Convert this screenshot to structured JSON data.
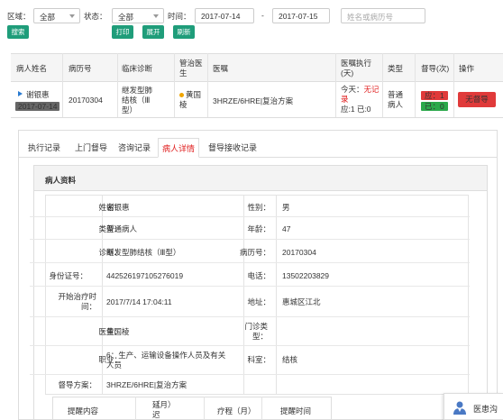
{
  "filters": {
    "region_label": "区域：",
    "region_value": "全部",
    "status_label": "状态：",
    "status_value": "全部",
    "time_label": "时间：",
    "date_from": "2017-07-14",
    "date_sep": "-",
    "date_to": "2017-07-15",
    "search_placeholder": "姓名或病历号",
    "search_btn": "搜索",
    "print_btn": "打印",
    "expand_btn": "展开",
    "refresh_btn": "刷新"
  },
  "table": {
    "headers": [
      "病人姓名",
      "病历号",
      "临床诊断",
      "管治医生",
      "医嘱",
      "医嘱执行(天)",
      "类型",
      "督导(次)",
      "操作"
    ],
    "row": {
      "name": "谢银惠",
      "date": "2017-07-14",
      "record_no": "20170304",
      "diagnosis_l1": "继发型肺",
      "diagnosis_l2": "结核（Ⅲ",
      "diagnosis_l3": "型）",
      "doctor_l1": "黄国",
      "doctor_l2": "棱",
      "order": "3HRZE/6HRE|复治方案",
      "exec_today": "今天：",
      "exec_status_l1": "无记",
      "exec_status_l2": "录",
      "exec_counts": "应:1 已:0",
      "type_l1": "普通",
      "type_l2": "病人",
      "due_badge": "应：1",
      "done_badge": "已：0",
      "action_btn": "无督导"
    }
  },
  "tabs": [
    "执行记录",
    "上门督导",
    "咨询记录",
    "病人详情",
    "督导接收记录"
  ],
  "active_tab": "病人详情",
  "profile": {
    "title": "病人资料",
    "name_k": "姓名：",
    "name_v": "谢银惠",
    "gender_k": "性别：",
    "gender_v": "男",
    "type_k": "类型：",
    "type_v": "普通病人",
    "age_k": "年龄：",
    "age_v": "47",
    "diag_k": "诊断：",
    "diag_v": "继发型肺结核（Ⅲ型）",
    "record_k": "病历号：",
    "record_v": "20170304",
    "id_k": "身份证号：",
    "id_v": "442526197105276019",
    "phone_k": "电话：",
    "phone_v": "13502203829",
    "start_k_l1": "开始治疗时",
    "start_k_l2": "间：",
    "start_v": "2017/7/14 17:04:11",
    "addr_k": "地址：",
    "addr_v": "惠城区江北",
    "doctor_k": "医生：",
    "doctor_v": "黄国棱",
    "clinic_k_l1": "门诊类",
    "clinic_k_l2": "型：",
    "clinic_v": "",
    "job_k": "职业：",
    "job_v_l1": "6：生产、运输设备操作人员及有关",
    "job_v_l2": "人员",
    "dept_k": "科室：",
    "dept_v": "结核",
    "plan_k": "督导方案：",
    "plan_v": "3HRZE/6HRE|复治方案"
  },
  "reminder_table": {
    "col1": "提醒内容",
    "col2_l1": "延迟时长",
    "col2_l2": "（月）",
    "col3": "疗程（月）",
    "col4": "提醒时间"
  },
  "float_widget": {
    "label": "医患沟"
  },
  "colors": {
    "teal": "#1f9d7a",
    "red": "#e02020",
    "blue": "#2a7bd1"
  }
}
